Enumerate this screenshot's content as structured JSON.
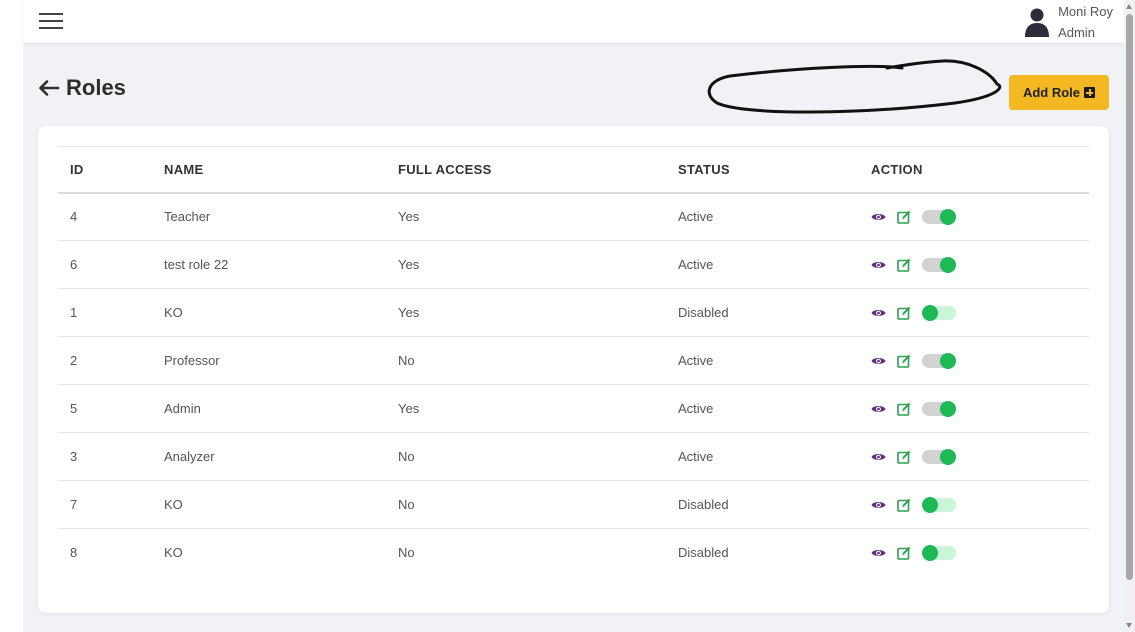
{
  "user": {
    "name": "Moni Roy",
    "role": "Admin"
  },
  "page": {
    "title": "Roles",
    "add_button_label": "Add Role"
  },
  "table": {
    "headers": [
      "ID",
      "NAME",
      "FULL ACCESS",
      "STATUS",
      "ACTION"
    ],
    "rows": [
      {
        "id": "4",
        "name": "Teacher",
        "full_access": "Yes",
        "status": "Active",
        "toggle_on": true
      },
      {
        "id": "6",
        "name": "test role 22",
        "full_access": "Yes",
        "status": "Active",
        "toggle_on": true
      },
      {
        "id": "1",
        "name": "KO",
        "full_access": "Yes",
        "status": "Disabled",
        "toggle_on": false
      },
      {
        "id": "2",
        "name": "Professor",
        "full_access": "No",
        "status": "Active",
        "toggle_on": true
      },
      {
        "id": "5",
        "name": "Admin",
        "full_access": "Yes",
        "status": "Active",
        "toggle_on": true
      },
      {
        "id": "3",
        "name": "Analyzer",
        "full_access": "No",
        "status": "Active",
        "toggle_on": true
      },
      {
        "id": "7",
        "name": "KO",
        "full_access": "No",
        "status": "Disabled",
        "toggle_on": false
      },
      {
        "id": "8",
        "name": "KO",
        "full_access": "No",
        "status": "Disabled",
        "toggle_on": false
      }
    ]
  },
  "icons": {
    "menu": "hamburger-menu-icon",
    "user": "user-avatar-icon",
    "back": "arrow-left-icon",
    "add": "plus-square-icon",
    "view": "eye-icon",
    "edit": "edit-icon"
  },
  "colors": {
    "background": "#f1f2f6",
    "accent_button": "#f3b822",
    "view_icon": "#5b2e86",
    "edit_icon": "#2e9e4f",
    "toggle_knob": "#1db954",
    "toggle_track_on": "#d2d2d2",
    "toggle_track_off": "#c9f5d9"
  }
}
